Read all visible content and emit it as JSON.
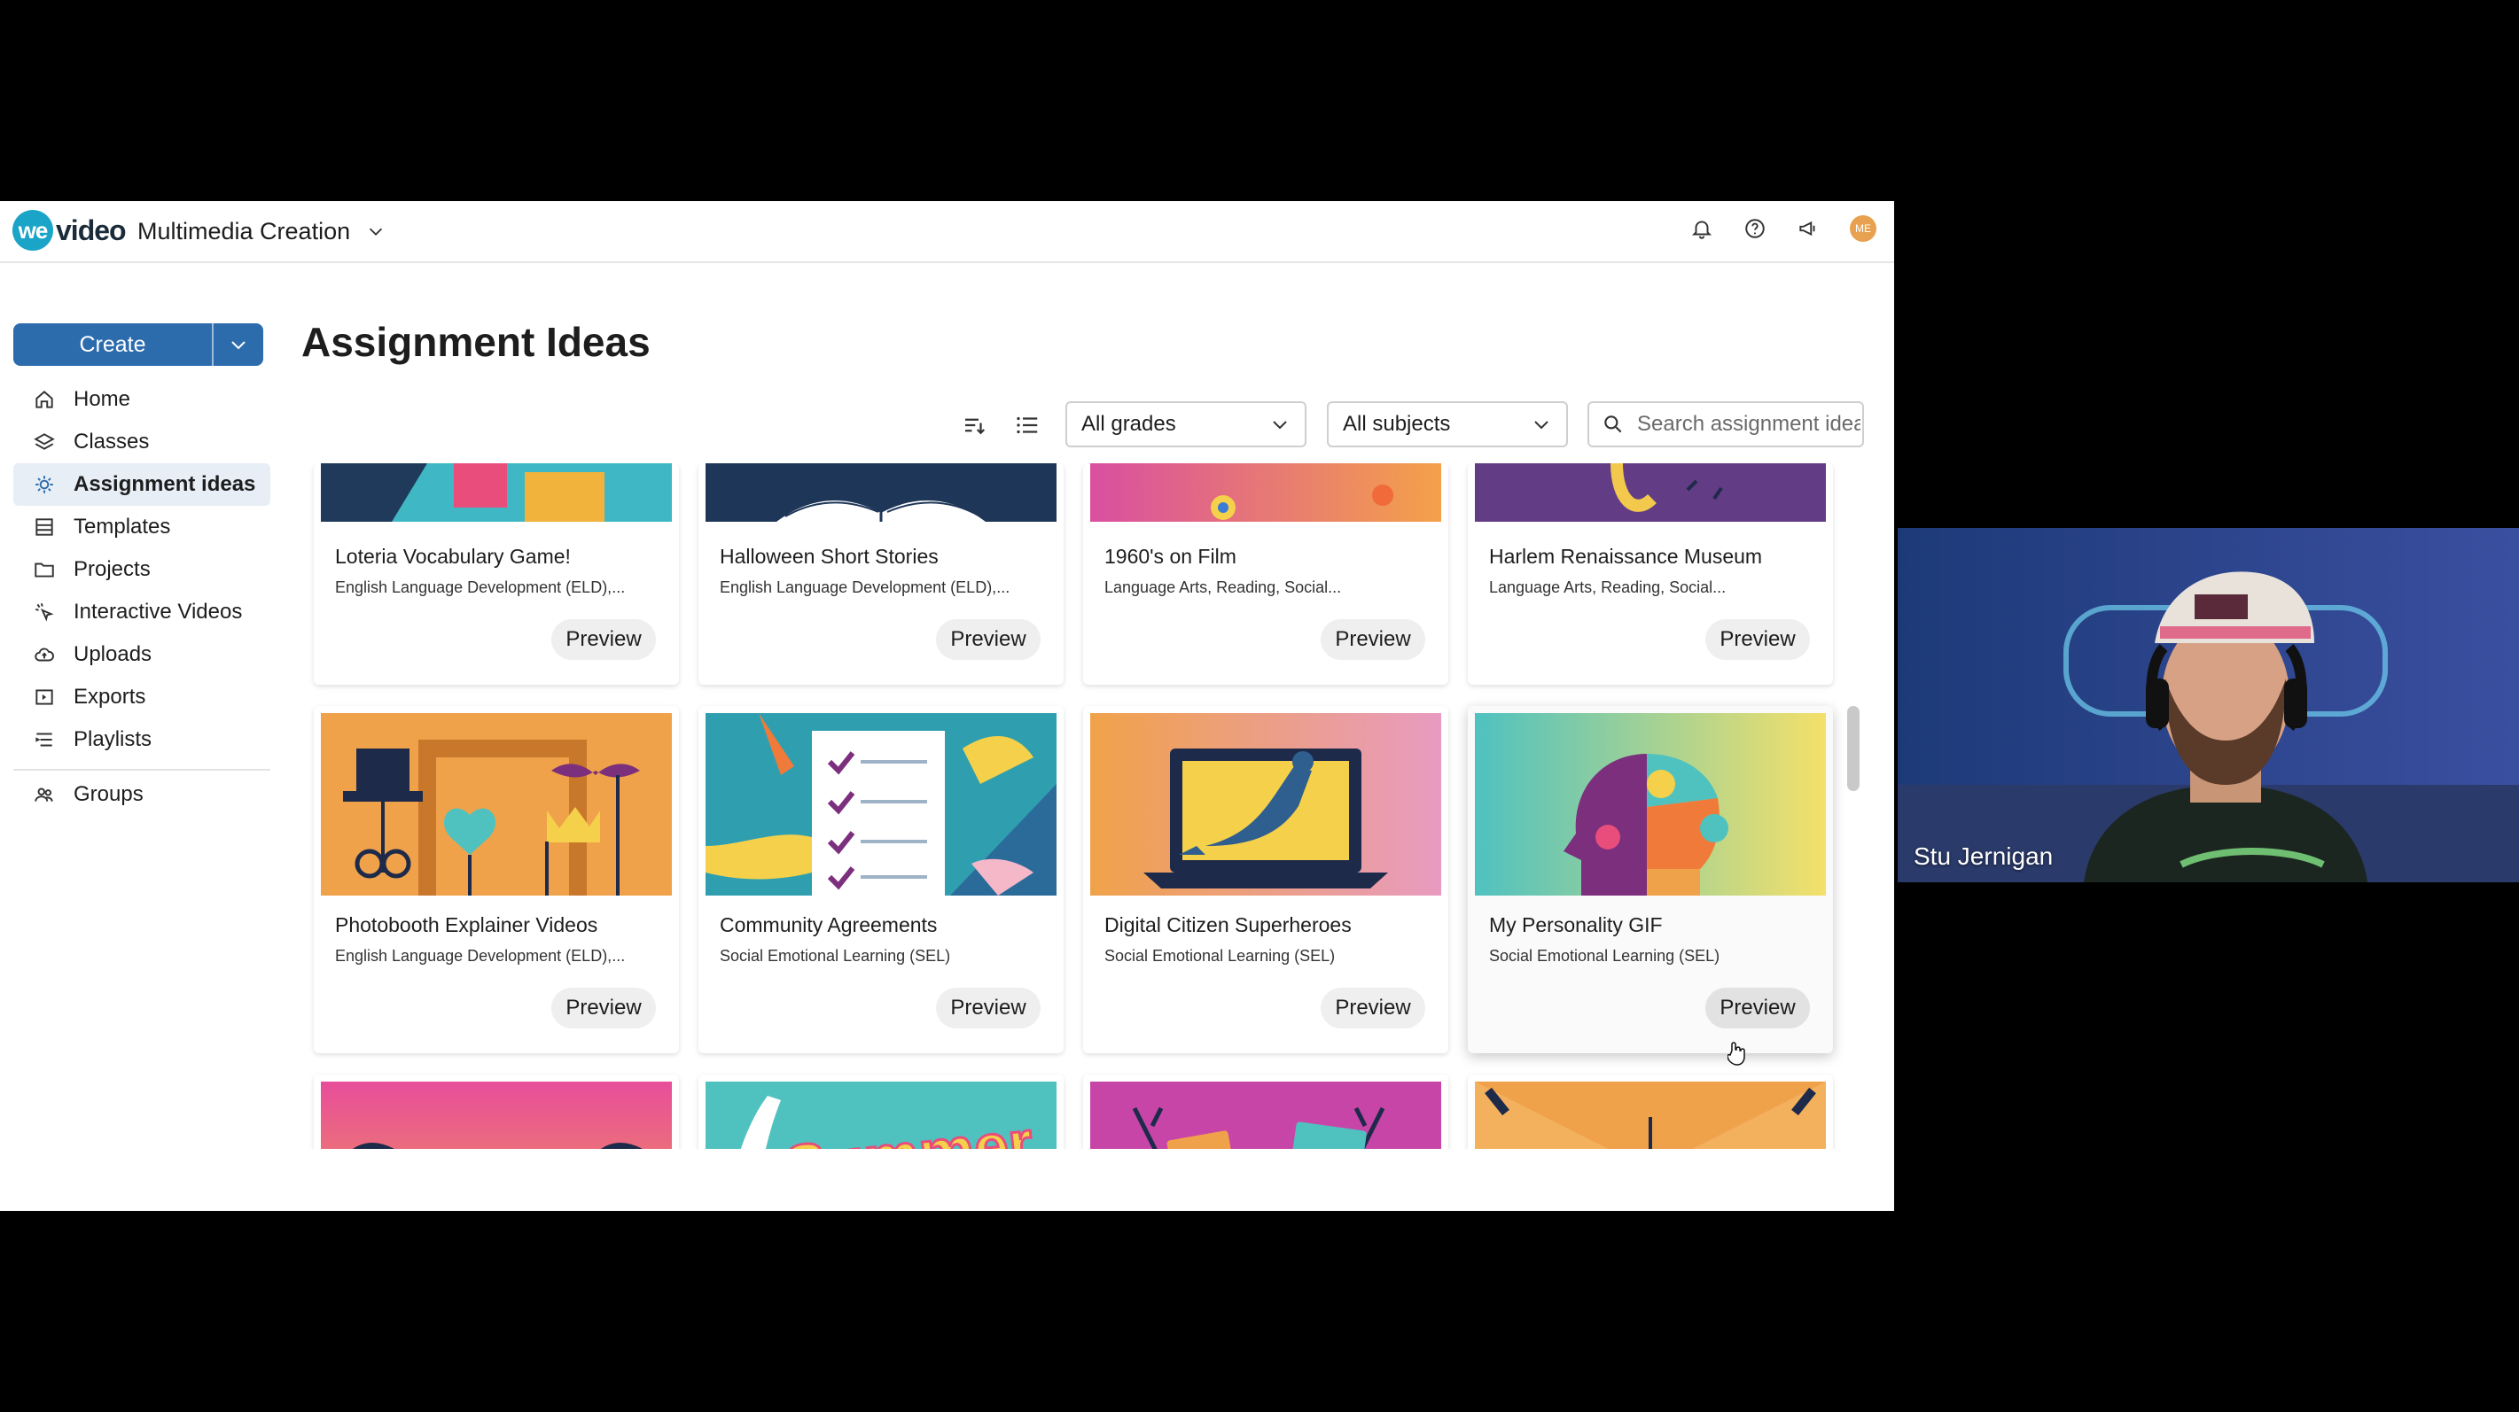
{
  "app": {
    "logo": {
      "we": "we",
      "video": "video"
    },
    "workspace": "Multimedia Creation",
    "avatar_initials": "ME"
  },
  "sidebar": {
    "create_label": "Create",
    "items": [
      {
        "label": "Home",
        "icon": "home-icon"
      },
      {
        "label": "Classes",
        "icon": "layers-icon"
      },
      {
        "label": "Assignment ideas",
        "icon": "lightbulb-icon",
        "active": true
      },
      {
        "label": "Templates",
        "icon": "templates-icon"
      },
      {
        "label": "Projects",
        "icon": "folder-icon"
      },
      {
        "label": "Interactive Videos",
        "icon": "interactive-icon"
      },
      {
        "label": "Uploads",
        "icon": "upload-cloud-icon"
      },
      {
        "label": "Exports",
        "icon": "export-icon"
      },
      {
        "label": "Playlists",
        "icon": "playlist-icon"
      },
      {
        "label": "Groups",
        "icon": "groups-icon"
      }
    ]
  },
  "main": {
    "title": "Assignment Ideas",
    "filters": {
      "grades": "All grades",
      "subjects": "All subjects",
      "search_placeholder": "Search assignment ideas"
    },
    "preview_label": "Preview",
    "cards": [
      {
        "title": "Loteria Vocabulary Game!",
        "subject": "English Language Development (ELD),..."
      },
      {
        "title": "Halloween Short Stories",
        "subject": "English Language Development (ELD),..."
      },
      {
        "title": "1960's on Film",
        "subject": "Language Arts, Reading, Social..."
      },
      {
        "title": "Harlem Renaissance Museum",
        "subject": "Language Arts, Reading, Social..."
      },
      {
        "title": "Photobooth Explainer Videos",
        "subject": "English Language Development (ELD),..."
      },
      {
        "title": "Community Agreements",
        "subject": "Social Emotional Learning (SEL)"
      },
      {
        "title": "Digital Citizen Superheroes",
        "subject": "Social Emotional Learning (SEL)"
      },
      {
        "title": "My Personality GIF",
        "subject": "Social Emotional Learning (SEL)"
      }
    ],
    "summer_text": "Summer"
  },
  "webcam": {
    "name": "Stu Jernigan"
  },
  "colors": {
    "accent": "#2c6cad",
    "active_nav_bg": "#e7eef6",
    "logo_teal": "#19a4c8"
  }
}
